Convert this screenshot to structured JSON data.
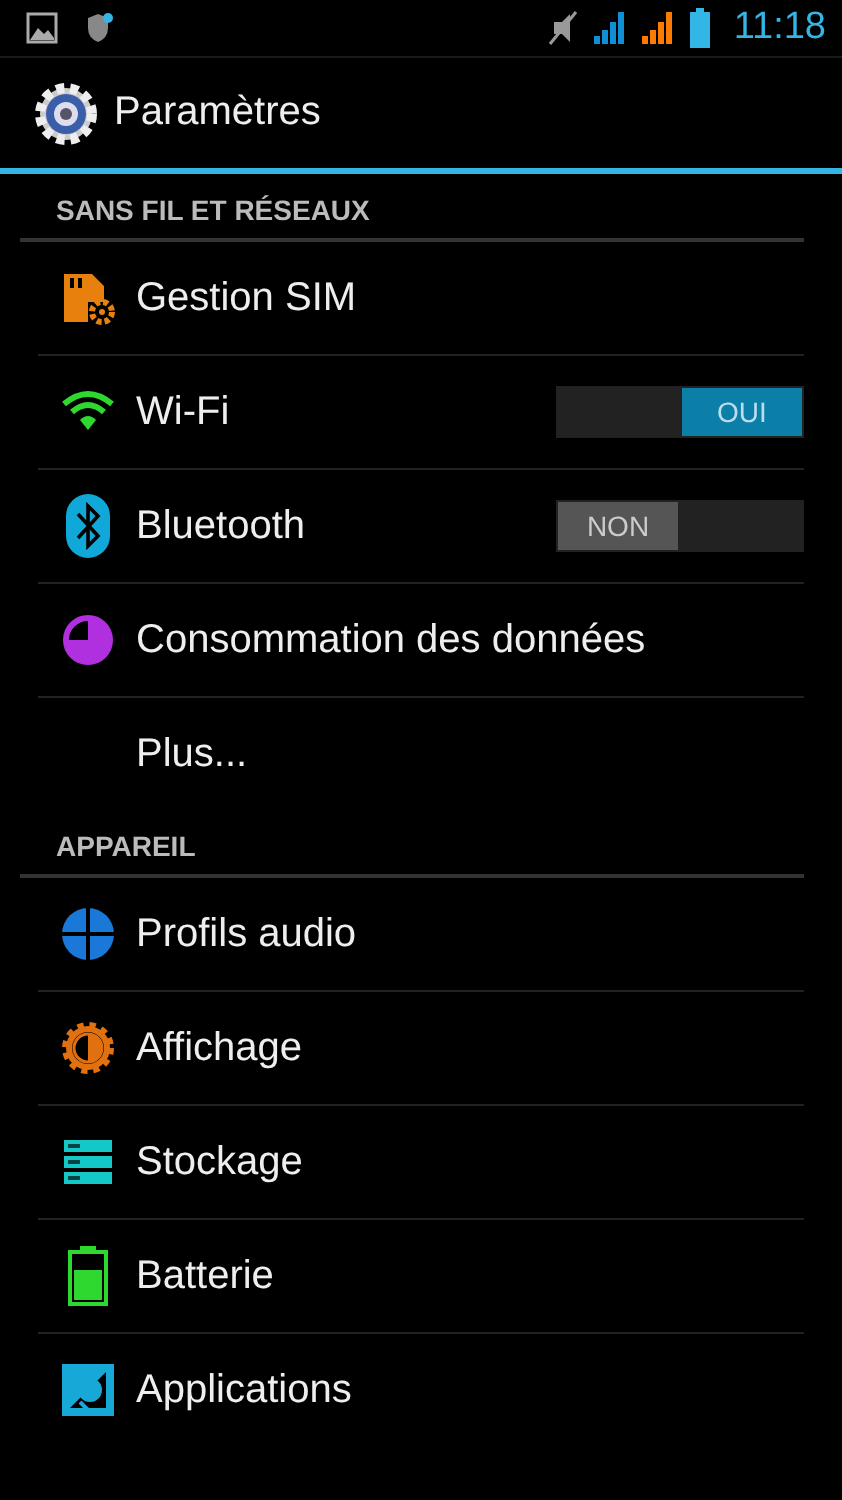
{
  "status_bar": {
    "time": "11:18"
  },
  "action_bar": {
    "title": "Paramètres"
  },
  "sections": [
    {
      "title": "SANS FIL ET RÉSEAUX",
      "items": [
        {
          "label": "Gestion SIM"
        },
        {
          "label": "Wi-Fi",
          "toggle": {
            "on": true,
            "label": "OUI"
          }
        },
        {
          "label": "Bluetooth",
          "toggle": {
            "on": false,
            "label": "NON"
          }
        },
        {
          "label": "Consommation des données"
        },
        {
          "label": "Plus..."
        }
      ]
    },
    {
      "title": "APPAREIL",
      "items": [
        {
          "label": "Profils audio"
        },
        {
          "label": "Affichage"
        },
        {
          "label": "Stockage"
        },
        {
          "label": "Batterie"
        },
        {
          "label": "Applications"
        }
      ]
    }
  ]
}
